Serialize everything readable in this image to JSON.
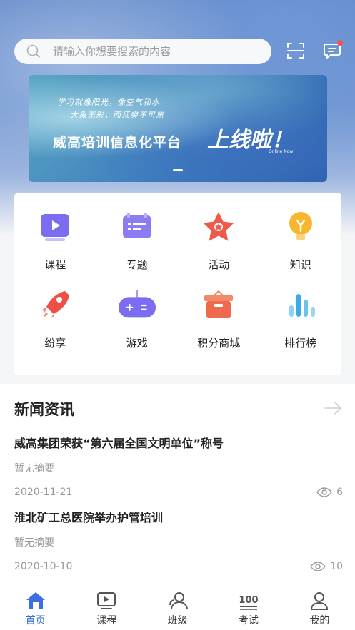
{
  "search": {
    "placeholder": "请输入你想要搜索的内容"
  },
  "banner": {
    "line1": "学习就像阳光，像空气和水",
    "line2": "大象无形，而须臾不可离",
    "title": "威高培训信息化平台",
    "title_big": "上线啦！",
    "online": "Online Now"
  },
  "grid": [
    {
      "label": "课程",
      "icon": "course-icon"
    },
    {
      "label": "专题",
      "icon": "topic-icon"
    },
    {
      "label": "活动",
      "icon": "activity-icon"
    },
    {
      "label": "知识",
      "icon": "knowledge-icon"
    },
    {
      "label": "纷享",
      "icon": "share-icon"
    },
    {
      "label": "游戏",
      "icon": "game-icon"
    },
    {
      "label": "积分商城",
      "icon": "points-mall-icon"
    },
    {
      "label": "排行榜",
      "icon": "ranking-icon"
    }
  ],
  "news": {
    "heading": "新闻资讯",
    "items": [
      {
        "title": "威高集团荣获“第六届全国文明单位”称号",
        "summary": "暂无摘要",
        "date": "2020-11-21",
        "views": "6"
      },
      {
        "title": "淮北矿工总医院举办护管培训",
        "summary": "暂无摘要",
        "date": "2020-10-10",
        "views": "10"
      }
    ]
  },
  "tabs": [
    {
      "label": "首页",
      "active": true
    },
    {
      "label": "课程"
    },
    {
      "label": "班级"
    },
    {
      "label": "考试"
    },
    {
      "label": "我的"
    }
  ],
  "colors": {
    "accent": "#3b6fe0",
    "badge": "#f0524f"
  }
}
